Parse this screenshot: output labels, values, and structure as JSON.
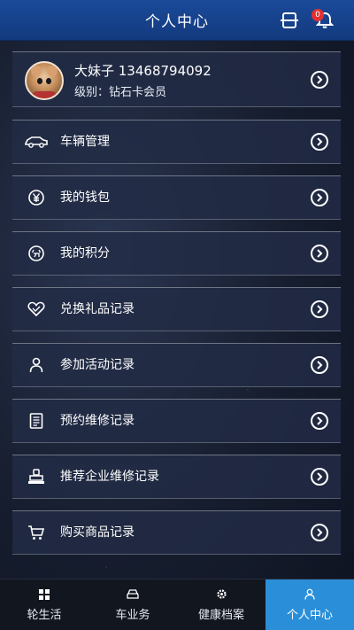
{
  "header": {
    "title": "个人中心",
    "bell_badge": "0"
  },
  "profile": {
    "name_phone": "大妹子 13468794092",
    "level": "级别：钻石卡会员"
  },
  "menu": [
    {
      "label": "车辆管理",
      "icon": "car-icon"
    },
    {
      "label": "我的钱包",
      "icon": "yen-icon"
    },
    {
      "label": "我的积分",
      "icon": "points-icon"
    },
    {
      "label": "兑换礼品记录",
      "icon": "heart-icon"
    },
    {
      "label": "参加活动记录",
      "icon": "person-icon"
    },
    {
      "label": "预约维修记录",
      "icon": "document-icon"
    },
    {
      "label": "推荐企业维修记录",
      "icon": "stamp-icon"
    },
    {
      "label": "购买商品记录",
      "icon": "cart-icon"
    }
  ],
  "tabs": [
    {
      "label": "轮生活",
      "icon": "grid-icon"
    },
    {
      "label": "车业务",
      "icon": "car-front-icon"
    },
    {
      "label": "健康档案",
      "icon": "gear-icon"
    },
    {
      "label": "个人中心",
      "icon": "person-icon",
      "active": true
    }
  ],
  "colors": {
    "header": "#1b4a9a",
    "active_tab": "#2a8fd8",
    "badge": "#e23030"
  }
}
